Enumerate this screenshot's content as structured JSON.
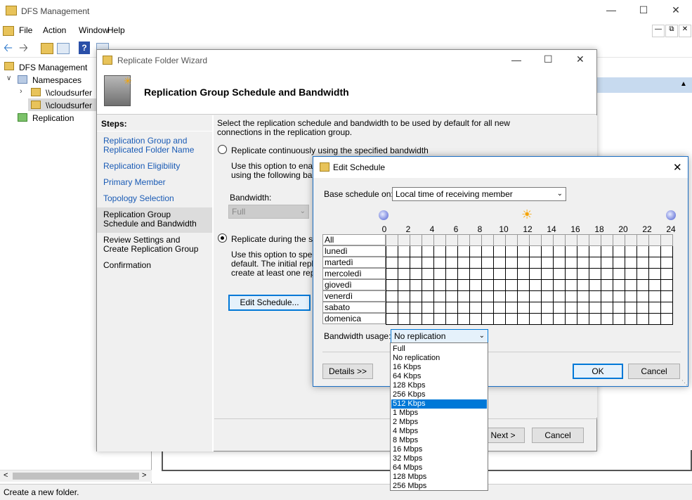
{
  "app": {
    "title": "DFS Management",
    "menu": [
      "File",
      "Action",
      "Window",
      "Help"
    ],
    "status": "Create a new folder."
  },
  "tree": {
    "root": "DFS Management",
    "namespaces": "Namespaces",
    "ns1": "\\\\cloudsurfer",
    "ns2": "\\\\cloudsurfer",
    "replication": "Replication"
  },
  "wizard": {
    "title": "Replicate Folder Wizard",
    "header": "Replication Group Schedule and Bandwidth",
    "steps_label": "Steps:",
    "steps": [
      "Replication Group and Replicated Folder Name",
      "Replication Eligibility",
      "Primary Member",
      "Topology Selection",
      "Replication Group Schedule and Bandwidth",
      "Review Settings and Create Replication Group",
      "Confirmation"
    ],
    "intro_line1": "Select the replication schedule and bandwidth to be used by default for all new",
    "intro_line2": "connections in the replication group.",
    "opt1_label": "Replicate continuously using the specified bandwidth",
    "opt1_desc1": "Use this option to enable",
    "opt1_desc2": "using the following bandw",
    "bandwidth_label": "Bandwidth:",
    "bandwidth_value": "Full",
    "opt2_label": "Replicate during the spec",
    "opt2_desc1": "Use this option to specify",
    "opt2_desc2": "default. The initial replicat",
    "opt2_desc3": "create at least one replica",
    "edit_schedule_btn": "Edit Schedule...",
    "next_btn": "Next >",
    "cancel_btn": "Cancel"
  },
  "schedule": {
    "title": "Edit Schedule",
    "base_label": "Base schedule on:",
    "base_value": "Local time of receiving member",
    "hours": [
      "0",
      "2",
      "4",
      "6",
      "8",
      "10",
      "12",
      "14",
      "16",
      "18",
      "20",
      "22",
      "24"
    ],
    "days": [
      "All",
      "lunedì",
      "martedì",
      "mercoledì",
      "giovedì",
      "venerdì",
      "sabato",
      "domenica"
    ],
    "bandwidth_label": "Bandwidth usage:",
    "bandwidth_value": "No replication",
    "details_btn": "Details >>",
    "ok_btn": "OK",
    "cancel_btn": "Cancel",
    "options": [
      "Full",
      "No replication",
      "16 Kbps",
      "64 Kbps",
      "128 Kbps",
      "256 Kbps",
      "512 Kbps",
      "1 Mbps",
      "2 Mbps",
      "4 Mbps",
      "8 Mbps",
      "16 Mbps",
      "32 Mbps",
      "64 Mbps",
      "128 Mbps",
      "256 Mbps"
    ],
    "selected_option": "512 Kbps"
  },
  "colors": {
    "accent": "#0078d7",
    "link": "#1a5bb5"
  }
}
